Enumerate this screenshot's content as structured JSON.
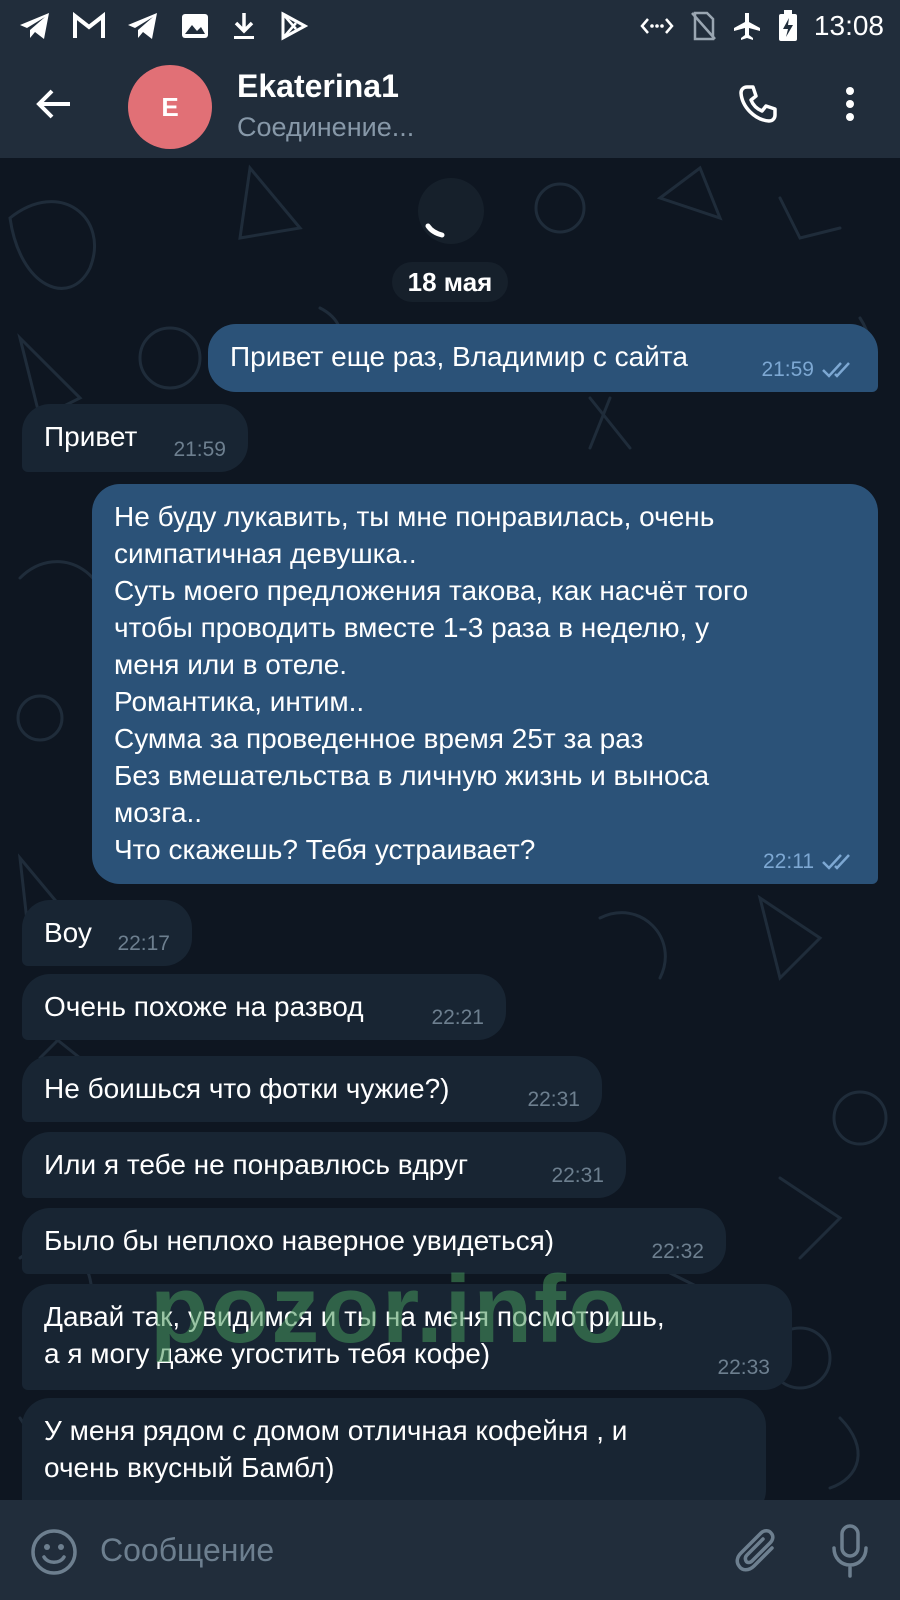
{
  "status_bar": {
    "time": "13:08",
    "left_icons": [
      "telegram-icon",
      "gmail-icon",
      "telegram-icon",
      "image-icon",
      "download-icon",
      "play-store-icon"
    ],
    "right_icons": [
      "data-arrows-icon",
      "no-sim-icon",
      "airplane-icon",
      "battery-charging-icon"
    ]
  },
  "header": {
    "avatar_letter": "E",
    "avatar_color": "#e17076",
    "name": "Ekaterina1",
    "status": "Соединение..."
  },
  "chat": {
    "date": "18 мая",
    "messages": [
      {
        "direction": "out",
        "text": "Привет еще раз, Владимир с сайта",
        "time": "21:59",
        "read": true
      },
      {
        "direction": "in",
        "text": "Привет",
        "time": "21:59"
      },
      {
        "direction": "out",
        "text": "Не буду лукавить, ты мне понравилась, очень\nсимпатичная девушка..\nСуть моего предложения такова, как насчёт того\nчтобы проводить вместе 1-3 раза в неделю, у\nменя или в отеле.\nРомантика, интим..\nСумма за проведенное время 25т за раз\nБез вмешательства в личную жизнь и выноса\nмозга..\nЧто скажешь? Тебя устраивает?",
        "time": "22:11",
        "read": true
      },
      {
        "direction": "in",
        "text": "Воу",
        "time": "22:17"
      },
      {
        "direction": "in",
        "text": "Очень похоже на развод",
        "time": "22:21"
      },
      {
        "direction": "in",
        "text": "Не боишься что фотки чужие?)",
        "time": "22:31"
      },
      {
        "direction": "in",
        "text": "Или я тебе не понравлюсь вдруг",
        "time": "22:31"
      },
      {
        "direction": "in",
        "text": "Было бы неплохо наверное увидеться)",
        "time": "22:32"
      },
      {
        "direction": "in",
        "text": "Давай так, увидимся и ты на меня посмотришь,\nа я могу даже угостить тебя кофе)",
        "time": "22:33"
      },
      {
        "direction": "in",
        "text": "У меня рядом с домом отличная кофейня , и\nочень вкусный Бамбл)",
        "time": ""
      }
    ],
    "watermark": "pozor.info"
  },
  "input": {
    "placeholder": "Сообщение"
  },
  "colors": {
    "header_bg": "#212d3b",
    "chat_bg": "#0e1621",
    "outgoing_bubble": "#2b5278",
    "incoming_bubble": "#182533",
    "read_check": "#7da8d3"
  }
}
